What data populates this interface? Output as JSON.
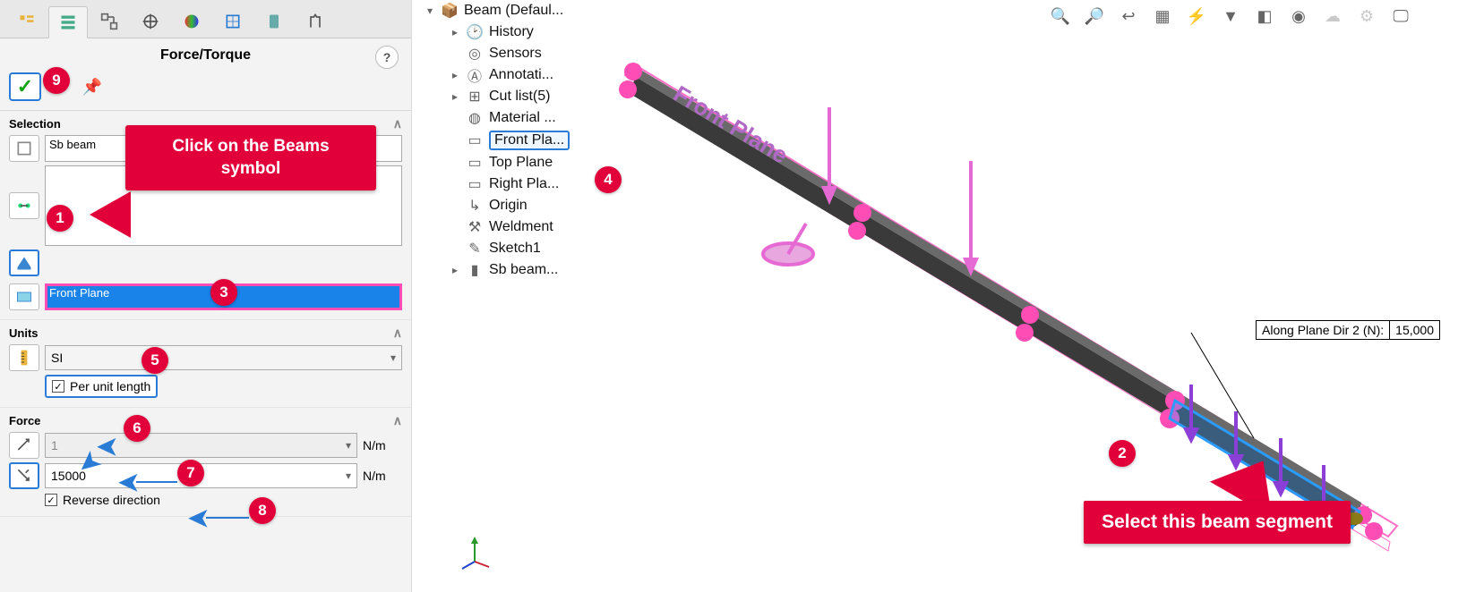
{
  "panel": {
    "title": "Force/Torque",
    "help_tooltip": "?",
    "sections": {
      "selection": {
        "header": "Selection",
        "beam_item": "Sb beam",
        "plane_item": "Front Plane"
      },
      "units": {
        "header": "Units",
        "system": "SI",
        "per_unit_label": "Per unit length"
      },
      "force": {
        "header": "Force",
        "dir1_value": "1",
        "dir1_unit": "N/m",
        "dir2_value": "15000",
        "dir2_unit": "N/m",
        "reverse_label": "Reverse direction"
      }
    }
  },
  "callouts": {
    "beams_symbol": "Click on the Beams symbol",
    "select_segment": "Select this beam segment"
  },
  "badges": {
    "b1": "1",
    "b2": "2",
    "b3": "3",
    "b4": "4",
    "b5": "5",
    "b6": "6",
    "b7": "7",
    "b8": "8",
    "b9": "9"
  },
  "tree": {
    "root": "Beam  (Defaul...",
    "items": [
      "History",
      "Sensors",
      "Annotati...",
      "Cut list(5)",
      "Material ...",
      "Front Pla...",
      "Top Plane",
      "Right Pla...",
      "Origin",
      "Weldment",
      "Sketch1",
      "Sb beam..."
    ]
  },
  "viewport": {
    "plane_label": "Front Plane",
    "force_indicator_label": "Along Plane Dir 2 (N):",
    "force_indicator_value": "15,000"
  }
}
